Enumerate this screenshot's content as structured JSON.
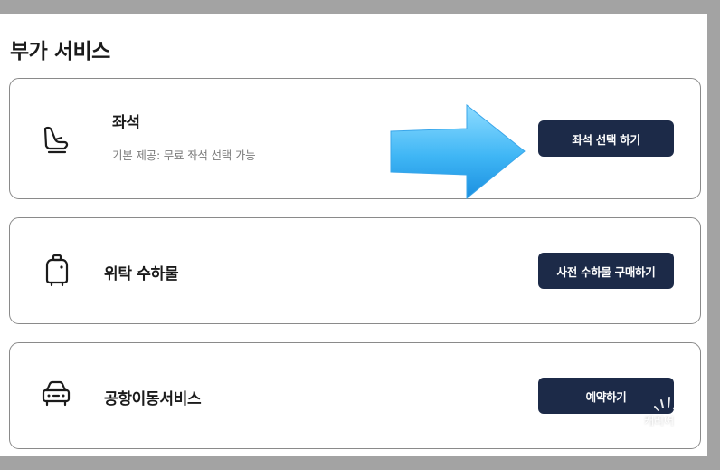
{
  "section": {
    "title": "부가 서비스"
  },
  "cards": [
    {
      "icon": "seat-icon",
      "title": "좌석",
      "subtitle": "기본 제공: 무료 좌석 선택 가능",
      "button": "좌석 선택 하기"
    },
    {
      "icon": "luggage-icon",
      "title": "위탁 수하물",
      "button": "사전 수하물 구매하기"
    },
    {
      "icon": "car-icon",
      "title": "공항이동서비스",
      "button": "예약하기"
    }
  ],
  "annotation": {
    "arrow_color": "#3fb6f5"
  },
  "watermark": {
    "text": "캐리어"
  },
  "colors": {
    "button_bg": "#1c2a48",
    "backdrop": "#a3a3a3"
  }
}
